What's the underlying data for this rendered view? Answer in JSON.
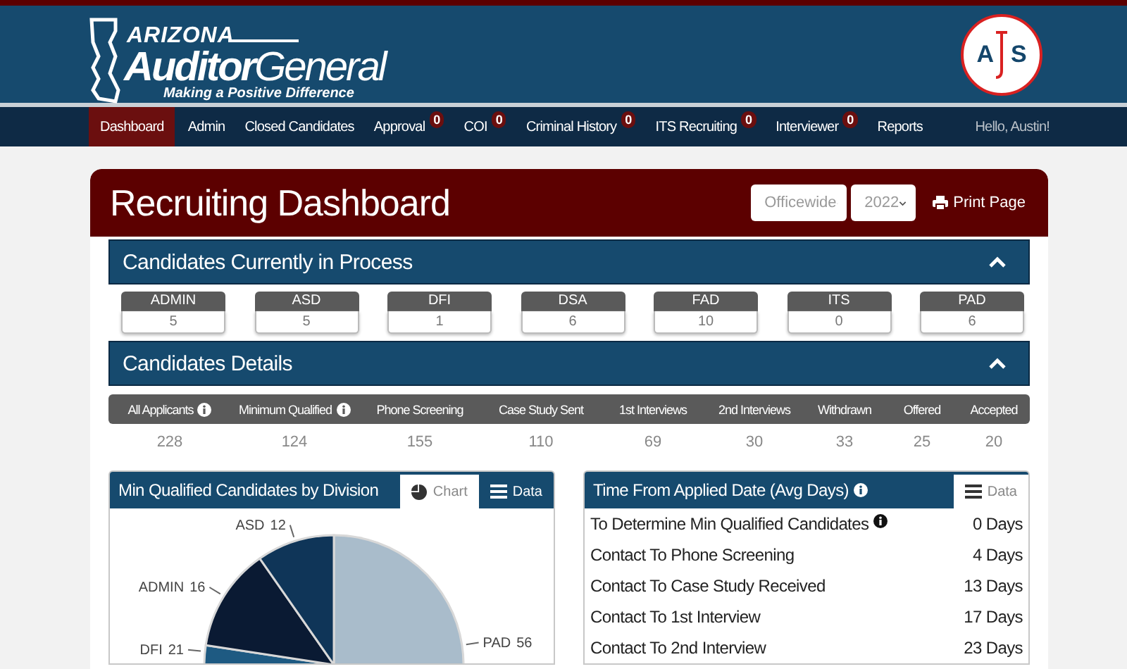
{
  "header": {
    "state_name": "ARIZONA",
    "title_bold": "Auditor",
    "title_light": "General",
    "tagline": "Making a Positive Difference",
    "monogram": [
      "A",
      "S"
    ]
  },
  "nav": {
    "items": [
      {
        "label": "Dashboard",
        "selected": true
      },
      {
        "label": "Admin",
        "selected": false
      },
      {
        "label": "Closed Candidates",
        "selected": false
      },
      {
        "label": "Approval",
        "badge": "0",
        "selected": false
      },
      {
        "label": "COI",
        "badge": "0",
        "selected": false
      },
      {
        "label": "Criminal History",
        "badge": "0",
        "selected": false
      },
      {
        "label": "ITS Recruiting",
        "badge": "0",
        "selected": false
      },
      {
        "label": "Interviewer",
        "badge": "0",
        "selected": false
      },
      {
        "label": "Reports",
        "selected": false
      }
    ],
    "greeting": "Hello, Austin!"
  },
  "dashboard": {
    "title": "Recruiting Dashboard",
    "filters": [
      {
        "value": "Officewide"
      },
      {
        "value": "2022"
      }
    ],
    "print_button": "Print Page",
    "in_process": {
      "title": "Candidates Currently in Process",
      "expanded": true,
      "divisions": [
        {
          "name": "ADMIN",
          "count": "5"
        },
        {
          "name": "ASD",
          "count": "5"
        },
        {
          "name": "DFI",
          "count": "1"
        },
        {
          "name": "DSA",
          "count": "6"
        },
        {
          "name": "FAD",
          "count": "10"
        },
        {
          "name": "ITS",
          "count": "0"
        },
        {
          "name": "PAD",
          "count": "6"
        }
      ]
    },
    "details": {
      "title": "Candidates Details",
      "expanded": true,
      "columns": [
        {
          "label": "All Applicants",
          "info": true,
          "value": "228"
        },
        {
          "label": "Minimum Qualified",
          "info": true,
          "value": "124"
        },
        {
          "label": "Phone Screening",
          "info": false,
          "value": "155"
        },
        {
          "label": "Case Study Sent",
          "info": false,
          "value": "110"
        },
        {
          "label": "1st Interviews",
          "info": false,
          "value": "69"
        },
        {
          "label": "2nd Interviews",
          "info": false,
          "value": "30"
        },
        {
          "label": "Withdrawn",
          "info": false,
          "value": "33"
        },
        {
          "label": "Offered",
          "info": false,
          "value": "25"
        },
        {
          "label": "Accepted",
          "info": false,
          "value": "20"
        }
      ]
    },
    "min_qualified_panel": {
      "title": "Min Qualified Candidates by Division",
      "tabs": [
        {
          "label": "Chart",
          "kind": "chart",
          "selected": true
        },
        {
          "label": "Data",
          "kind": "data",
          "selected": false
        }
      ],
      "chart_data": {
        "type": "pie",
        "categories": [
          "PAD",
          "DFI",
          "ADMIN",
          "ASD"
        ],
        "values": [
          56,
          21,
          16,
          12
        ],
        "data_labels": true
      }
    },
    "time_panel": {
      "title": "Time From Applied Date (Avg Days)",
      "info": true,
      "tabs": [
        {
          "label": "Data",
          "kind": "data",
          "selected": true
        }
      ],
      "rows": [
        {
          "label": "To Determine Min Qualified Candidates",
          "info": true,
          "value": "0 Days"
        },
        {
          "label": "Contact To Phone Screening",
          "info": false,
          "value": "4 Days"
        },
        {
          "label": "Contact To Case Study Received",
          "info": false,
          "value": "13 Days"
        },
        {
          "label": "Contact To 1st Interview",
          "info": false,
          "value": "17 Days"
        },
        {
          "label": "Contact To 2nd Interview",
          "info": false,
          "value": "23 Days"
        }
      ]
    }
  }
}
